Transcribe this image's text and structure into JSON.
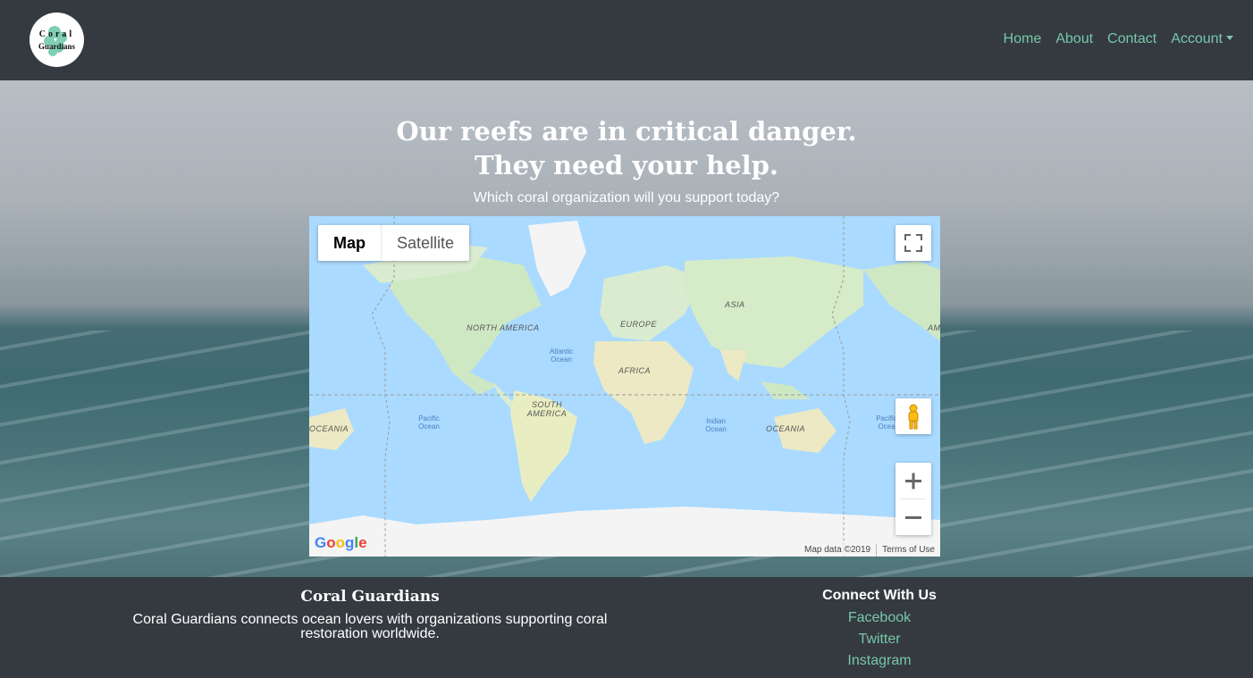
{
  "brand": {
    "logo_line1": "Coral",
    "logo_line2": "Guardians"
  },
  "nav": {
    "items": [
      "Home",
      "About",
      "Contact"
    ],
    "account_label": "Account"
  },
  "hero": {
    "headline_line1": "Our reefs are in critical danger.",
    "headline_line2": "They need your help.",
    "subheading": "Which coral organization will you support today?"
  },
  "map": {
    "type_options": [
      "Map",
      "Satellite"
    ],
    "selected_type": "Map",
    "continent_labels": [
      "NORTH AMERICA",
      "SOUTH AMERICA",
      "EUROPE",
      "AFRICA",
      "ASIA",
      "OCEANIA",
      "OCEANIA"
    ],
    "ocean_labels": [
      "Atlantic Ocean",
      "Pacific Ocean",
      "Indian Ocean",
      "Pacific Ocea"
    ],
    "clipped_labels": [
      "AM"
    ],
    "google_logo": "Google",
    "attribution": "Map data ©2019",
    "terms": "Terms of Use",
    "zoom_in": "+",
    "zoom_out": "−"
  },
  "footer": {
    "title": "Coral Guardians",
    "description": "Coral Guardians connects ocean lovers with organizations supporting coral restoration worldwide.",
    "connect_heading": "Connect With Us",
    "links": [
      "Facebook",
      "Twitter",
      "Instagram"
    ]
  },
  "colors": {
    "navbar_bg": "#343a40",
    "link": "#79c7a9",
    "map_water": "#aadaff",
    "map_land": "#cfe8c4"
  }
}
